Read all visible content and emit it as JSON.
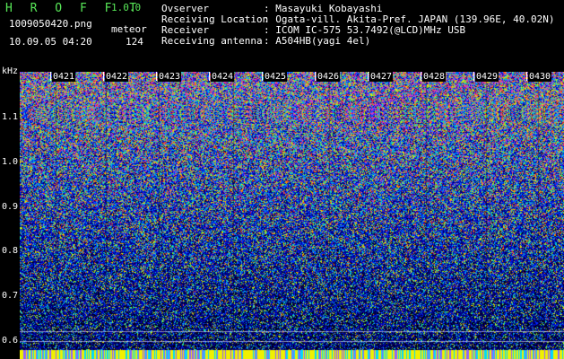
{
  "app": {
    "name": "H R O F F T",
    "version": "1.0.0"
  },
  "file": {
    "name": "1009050420.png",
    "datetime": "10.09.05 04:20"
  },
  "meteor": {
    "label": "meteor",
    "count": "124"
  },
  "info": [
    {
      "label": "Ovserver",
      "value": ": Masayuki Kobayashi"
    },
    {
      "label": "Receiving Location",
      "value": ": Ogata-vill. Akita-Pref. JAPAN (139.96E, 40.02N)"
    },
    {
      "label": "Receiver",
      "value": ": ICOM IC-575 53.7492(@LCD)MHz USB"
    },
    {
      "label": "Receiving antenna",
      "value": ": A504HB(yagi 4el)"
    }
  ],
  "waterfall": {
    "freq_unit": "kHz",
    "freq_labels": [
      "1.1",
      "1.0",
      "0.9",
      "0.8",
      "0.7",
      "0.6"
    ],
    "time_labels": [
      "0421",
      "0422",
      "0423",
      "0424",
      "0425",
      "0426",
      "0427",
      "0428",
      "0429",
      "0430"
    ]
  }
}
